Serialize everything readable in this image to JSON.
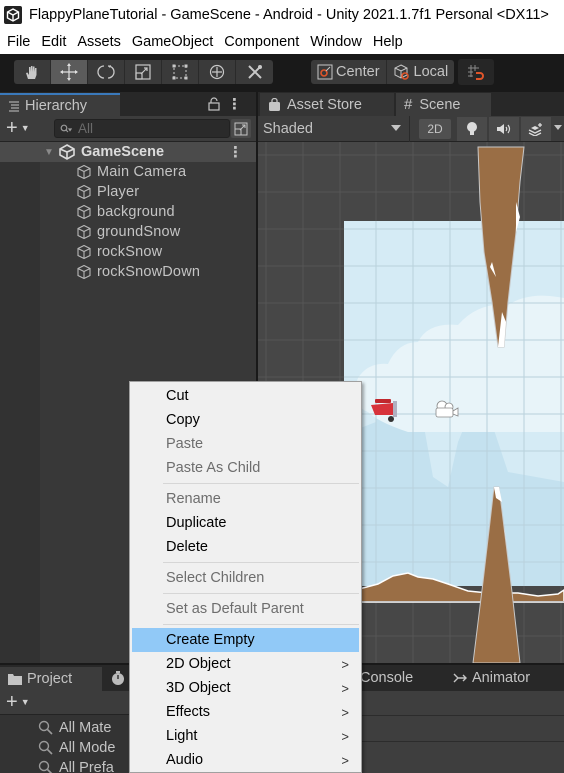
{
  "window": {
    "title": "FlappyPlaneTutorial - GameScene - Android - Unity 2021.1.7f1 Personal <DX11>",
    "app_icon": "unity-logo-icon"
  },
  "menubar": {
    "items": [
      "File",
      "Edit",
      "Assets",
      "GameObject",
      "Component",
      "Window",
      "Help"
    ]
  },
  "toolbar": {
    "tools": [
      {
        "name": "hand-tool",
        "icon": "hand-icon",
        "active": false
      },
      {
        "name": "move-tool",
        "icon": "move-arrows-icon",
        "active": true
      },
      {
        "name": "rotate-tool",
        "icon": "rotate-icon",
        "active": false
      },
      {
        "name": "scale-tool",
        "icon": "scale-icon",
        "active": false
      },
      {
        "name": "rect-tool",
        "icon": "rect-transform-icon",
        "active": false
      },
      {
        "name": "transform-tool",
        "icon": "transform-icon",
        "active": false
      },
      {
        "name": "custom-tool",
        "icon": "tools-icon",
        "active": false
      }
    ],
    "pivot_label": "Center",
    "space_label": "Local",
    "snap_icon": "grid-snap-magnet-icon"
  },
  "hierarchy": {
    "tab_label": "Hierarchy",
    "search_placeholder": "All",
    "scene_name": "GameScene",
    "items": [
      "Main Camera",
      "Player",
      "background",
      "groundSnow",
      "rockSnow",
      "rockSnowDown"
    ]
  },
  "scene_view": {
    "tabs": [
      {
        "label": "Asset Store",
        "icon": "bag-icon",
        "active": false
      },
      {
        "label": "Scene",
        "icon": "hash-icon",
        "active": true
      }
    ],
    "shading_mode": "Shaded",
    "mode_2d_label": "2D",
    "colors": {
      "sky": "#d5ebf5",
      "rock": "#9a6e45",
      "snow": "#ffffff",
      "grid_bg": "#474747"
    }
  },
  "bottom_panel": {
    "project_tab": "Project",
    "console_tab": "Console",
    "animator_tab": "Animator",
    "search_items": [
      "All Mate",
      "All Mode",
      "All Prefa"
    ]
  },
  "context_menu": {
    "items": [
      {
        "label": "Cut",
        "enabled": true
      },
      {
        "label": "Copy",
        "enabled": true
      },
      {
        "label": "Paste",
        "enabled": false
      },
      {
        "label": "Paste As Child",
        "enabled": false
      },
      {
        "separator": true
      },
      {
        "label": "Rename",
        "enabled": false
      },
      {
        "label": "Duplicate",
        "enabled": true
      },
      {
        "label": "Delete",
        "enabled": true
      },
      {
        "separator": true
      },
      {
        "label": "Select Children",
        "enabled": false
      },
      {
        "separator": true
      },
      {
        "label": "Set as Default Parent",
        "enabled": false
      },
      {
        "separator": true
      },
      {
        "label": "Create Empty",
        "enabled": true,
        "highlighted": true
      },
      {
        "label": "2D Object",
        "enabled": true,
        "submenu": true
      },
      {
        "label": "3D Object",
        "enabled": true,
        "submenu": true
      },
      {
        "label": "Effects",
        "enabled": true,
        "submenu": true
      },
      {
        "label": "Light",
        "enabled": true,
        "submenu": true
      },
      {
        "label": "Audio",
        "enabled": true,
        "submenu": true
      }
    ],
    "highlight_color": "#91c9f7"
  }
}
